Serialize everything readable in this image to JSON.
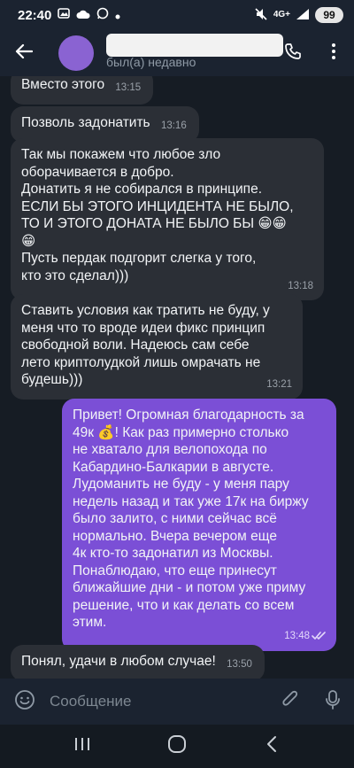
{
  "status_bar": {
    "time": "22:40",
    "network": "4G+",
    "battery": "99",
    "icons": [
      "photo-icon",
      "cloud-icon",
      "whatsapp-icon",
      "dot-icon",
      "mute-icon",
      "signal-icon"
    ]
  },
  "header": {
    "contact_name": "",
    "last_seen": "был(а) недавно",
    "icons": [
      "back-arrow-icon",
      "phone-icon",
      "more-vertical-icon"
    ]
  },
  "messages": [
    {
      "direction": "in",
      "text": "Вместо этого",
      "time": "13:15"
    },
    {
      "direction": "in",
      "text": "Позволь задонатить",
      "time": "13:16"
    },
    {
      "direction": "in",
      "text": "Так мы покажем что любое зло\nоборачивается в добро.\nДонатить я не собирался в принципе.\nЕСЛИ БЫ ЭТОГО ИНЦИДЕНТА НЕ БЫЛО,\nТО И ЭТОГО ДОНАТА НЕ БЫЛО БЫ 😁😁\n😁\nПусть пердак подгорит слегка у того,\nкто это сделал)))",
      "time": "13:18"
    },
    {
      "direction": "in",
      "text": "Ставить условия как тратить не буду, у\nменя что то вроде идеи фикс принцип\nсвободной воли. Надеюсь сам себе\nлето криптолудкой лишь омрачать не\nбудешь)))",
      "time": "13:21"
    },
    {
      "direction": "out",
      "text": "Привет! Огромная благодарность за\n49к 💰! Как раз примерно столько\nне хватало для велопохода по\nКабардино-Балкарии в августе.\nЛудоманить не буду - у меня пару\nнедель назад и так уже 17к на биржу\nбыло залито, с ними сейчас всё\nнормально. Вчера вечером еще\n4к кто-то задонатил из Москвы.\nПонаблюдаю, что еще принесут\nближайшие дни - и потом уже приму\nрешение, что и как делать со всем\nэтим.",
      "time": "13:48",
      "status": "read"
    },
    {
      "direction": "in",
      "text": "Понял, удачи в любом случае!",
      "time": "13:50"
    }
  ],
  "input": {
    "placeholder": "Сообщение",
    "icons": [
      "emoji-icon",
      "attach-icon",
      "microphone-icon"
    ]
  },
  "nav_bar": {
    "icons": [
      "recent-apps-icon",
      "home-icon",
      "back-icon"
    ]
  },
  "colors": {
    "incoming_bubble": "#2b2f36",
    "outgoing_bubble": "#7b4fd6",
    "avatar": "#8a63d2",
    "header": "#1b2330"
  }
}
